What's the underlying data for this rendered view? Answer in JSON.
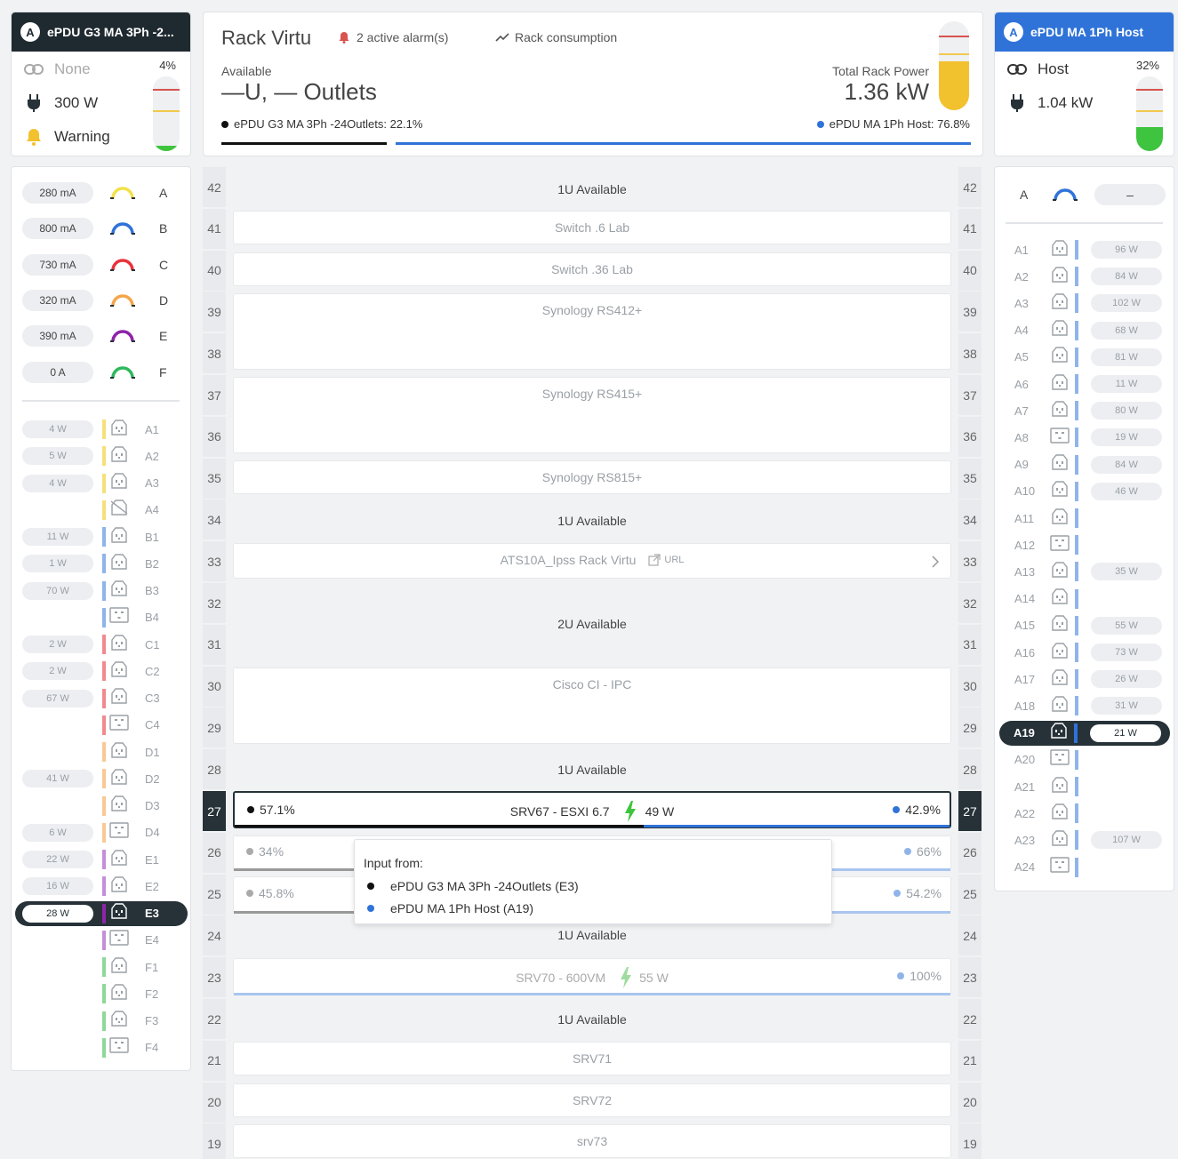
{
  "colors": {
    "dark": "#263238",
    "blue": "#2f73d9",
    "yellow": "#f2c94c",
    "green": "#3ec43e",
    "red": "#d9534f"
  },
  "left_pdu": {
    "badge": "A",
    "name": "ePDU G3 MA 3Ph -2...",
    "link_label": "None",
    "power": "300 W",
    "status": "Warning",
    "percent": "4%",
    "gauge_fraction": 0.04,
    "phases": [
      {
        "current": "280 mA",
        "letter": "A",
        "color": "#f2e14c"
      },
      {
        "current": "800 mA",
        "letter": "B",
        "color": "#2f73d9"
      },
      {
        "current": "730 mA",
        "letter": "C",
        "color": "#e8333c"
      },
      {
        "current": "320 mA",
        "letter": "D",
        "color": "#f5a54a"
      },
      {
        "current": "390 mA",
        "letter": "E",
        "color": "#8e24aa"
      },
      {
        "current": "0 A",
        "letter": "F",
        "color": "#2eb85c"
      }
    ],
    "outlets": [
      {
        "power": "4 W",
        "label": "A1",
        "color": "#f5e07a",
        "type": "c13"
      },
      {
        "power": "5 W",
        "label": "A2",
        "color": "#f5e07a",
        "type": "c13"
      },
      {
        "power": "4 W",
        "label": "A3",
        "color": "#f5e07a",
        "type": "c13"
      },
      {
        "power": "",
        "label": "A4",
        "color": "#f5e07a",
        "type": "off"
      },
      {
        "power": "11 W",
        "label": "B1",
        "color": "#8fb4ea",
        "type": "c13"
      },
      {
        "power": "1 W",
        "label": "B2",
        "color": "#8fb4ea",
        "type": "c13"
      },
      {
        "power": "70 W",
        "label": "B3",
        "color": "#8fb4ea",
        "type": "c13"
      },
      {
        "power": "",
        "label": "B4",
        "color": "#8fb4ea",
        "type": "c19"
      },
      {
        "power": "2 W",
        "label": "C1",
        "color": "#f08a8f",
        "type": "c13"
      },
      {
        "power": "2 W",
        "label": "C2",
        "color": "#f08a8f",
        "type": "c13"
      },
      {
        "power": "67 W",
        "label": "C3",
        "color": "#f08a8f",
        "type": "c13"
      },
      {
        "power": "",
        "label": "C4",
        "color": "#f08a8f",
        "type": "c19"
      },
      {
        "power": "",
        "label": "D1",
        "color": "#f8c995",
        "type": "c13"
      },
      {
        "power": "41 W",
        "label": "D2",
        "color": "#f8c995",
        "type": "c13"
      },
      {
        "power": "",
        "label": "D3",
        "color": "#f8c995",
        "type": "c13"
      },
      {
        "power": "6 W",
        "label": "D4",
        "color": "#f8c995",
        "type": "c19"
      },
      {
        "power": "22 W",
        "label": "E1",
        "color": "#c48fd8",
        "type": "c13"
      },
      {
        "power": "16 W",
        "label": "E2",
        "color": "#c48fd8",
        "type": "c13"
      },
      {
        "power": "28 W",
        "label": "E3",
        "color": "#8e24aa",
        "type": "c13",
        "selected": true
      },
      {
        "power": "",
        "label": "E4",
        "color": "#c48fd8",
        "type": "c19"
      },
      {
        "power": "",
        "label": "F1",
        "color": "#8fd89a",
        "type": "c13"
      },
      {
        "power": "",
        "label": "F2",
        "color": "#8fd89a",
        "type": "c13"
      },
      {
        "power": "",
        "label": "F3",
        "color": "#8fd89a",
        "type": "c13"
      },
      {
        "power": "",
        "label": "F4",
        "color": "#8fd89a",
        "type": "c19"
      }
    ]
  },
  "rack": {
    "title": "Rack Virtu",
    "alarms": "2 active alarm(s)",
    "consumption": "Rack consumption",
    "available_label": "Available",
    "available_value": "—U, — Outlets",
    "total_label": "Total Rack Power",
    "total_value": "1.36 kW",
    "share_left": "ePDU G3 MA 3Ph -24Outlets: 22.1%",
    "share_right": "ePDU MA 1Ph Host: 76.8%",
    "share_left_fraction": 0.221,
    "share_right_fraction": 0.768,
    "gauge_fraction": 0.55,
    "units": [
      42,
      41,
      40,
      39,
      38,
      37,
      36,
      35,
      34,
      33,
      32,
      31,
      30,
      29,
      28,
      27,
      26,
      25,
      24,
      23,
      22,
      21,
      20,
      19
    ],
    "available": {
      "u42": "1U Available",
      "u34": "1U Available",
      "u32": "2U Available",
      "u28": "1U Available",
      "u24": "1U Available",
      "u22": "1U Available"
    },
    "devices": {
      "switch6": "Switch .6 Lab",
      "switch36": "Switch .36 Lab",
      "rs412": "Synology RS412+",
      "rs415": "Synology RS415+",
      "rs815": "Synology RS815+",
      "ats": "ATS10A_Ipss Rack Virtu",
      "ats_url": "URL",
      "cisco": "Cisco CI - IPC",
      "srv67": "SRV67 - ESXI 6.7",
      "srv67_power": "49 W",
      "srv67_left": "57.1%",
      "srv67_right": "42.9%",
      "srv67_left_fraction": 0.571,
      "srv26_left": "34%",
      "srv26_right": "66%",
      "srv26_left_fraction": 0.34,
      "srv25_left": "45.8%",
      "srv25_right": "54.2%",
      "srv25_left_fraction": 0.458,
      "srv70": "SRV70 - 600VM",
      "srv70_power": "55 W",
      "srv70_right": "100%",
      "srv71": "SRV71",
      "srv72": "SRV72",
      "srv73": "srv73"
    },
    "tooltip": {
      "title": "Input from:",
      "line1": "ePDU G3 MA 3Ph -24Outlets (E3)",
      "line2": "ePDU MA 1Ph Host (A19)"
    }
  },
  "right_pdu": {
    "badge": "A",
    "name": "ePDU MA 1Ph Host",
    "link_label": "Host",
    "power": "1.04 kW",
    "percent": "32%",
    "gauge_fraction": 0.32,
    "phase_letter": "A",
    "phase_value": "–",
    "outlets": [
      {
        "label": "A1",
        "power": "96 W",
        "type": "c13"
      },
      {
        "label": "A2",
        "power": "84 W",
        "type": "c13"
      },
      {
        "label": "A3",
        "power": "102 W",
        "type": "c13"
      },
      {
        "label": "A4",
        "power": "68 W",
        "type": "c13"
      },
      {
        "label": "A5",
        "power": "81 W",
        "type": "c13"
      },
      {
        "label": "A6",
        "power": "11 W",
        "type": "c13"
      },
      {
        "label": "A7",
        "power": "80 W",
        "type": "c13"
      },
      {
        "label": "A8",
        "power": "19 W",
        "type": "c19"
      },
      {
        "label": "A9",
        "power": "84 W",
        "type": "c13"
      },
      {
        "label": "A10",
        "power": "46 W",
        "type": "c13"
      },
      {
        "label": "A11",
        "power": "",
        "type": "c13"
      },
      {
        "label": "A12",
        "power": "",
        "type": "c19"
      },
      {
        "label": "A13",
        "power": "35 W",
        "type": "c13"
      },
      {
        "label": "A14",
        "power": "",
        "type": "c13"
      },
      {
        "label": "A15",
        "power": "55 W",
        "type": "c13"
      },
      {
        "label": "A16",
        "power": "73 W",
        "type": "c13"
      },
      {
        "label": "A17",
        "power": "26 W",
        "type": "c13"
      },
      {
        "label": "A18",
        "power": "31 W",
        "type": "c13"
      },
      {
        "label": "A19",
        "power": "21 W",
        "type": "c13",
        "selected": true
      },
      {
        "label": "A20",
        "power": "",
        "type": "c19"
      },
      {
        "label": "A21",
        "power": "",
        "type": "c13"
      },
      {
        "label": "A22",
        "power": "",
        "type": "c13"
      },
      {
        "label": "A23",
        "power": "107 W",
        "type": "c13"
      },
      {
        "label": "A24",
        "power": "",
        "type": "c19"
      }
    ]
  }
}
